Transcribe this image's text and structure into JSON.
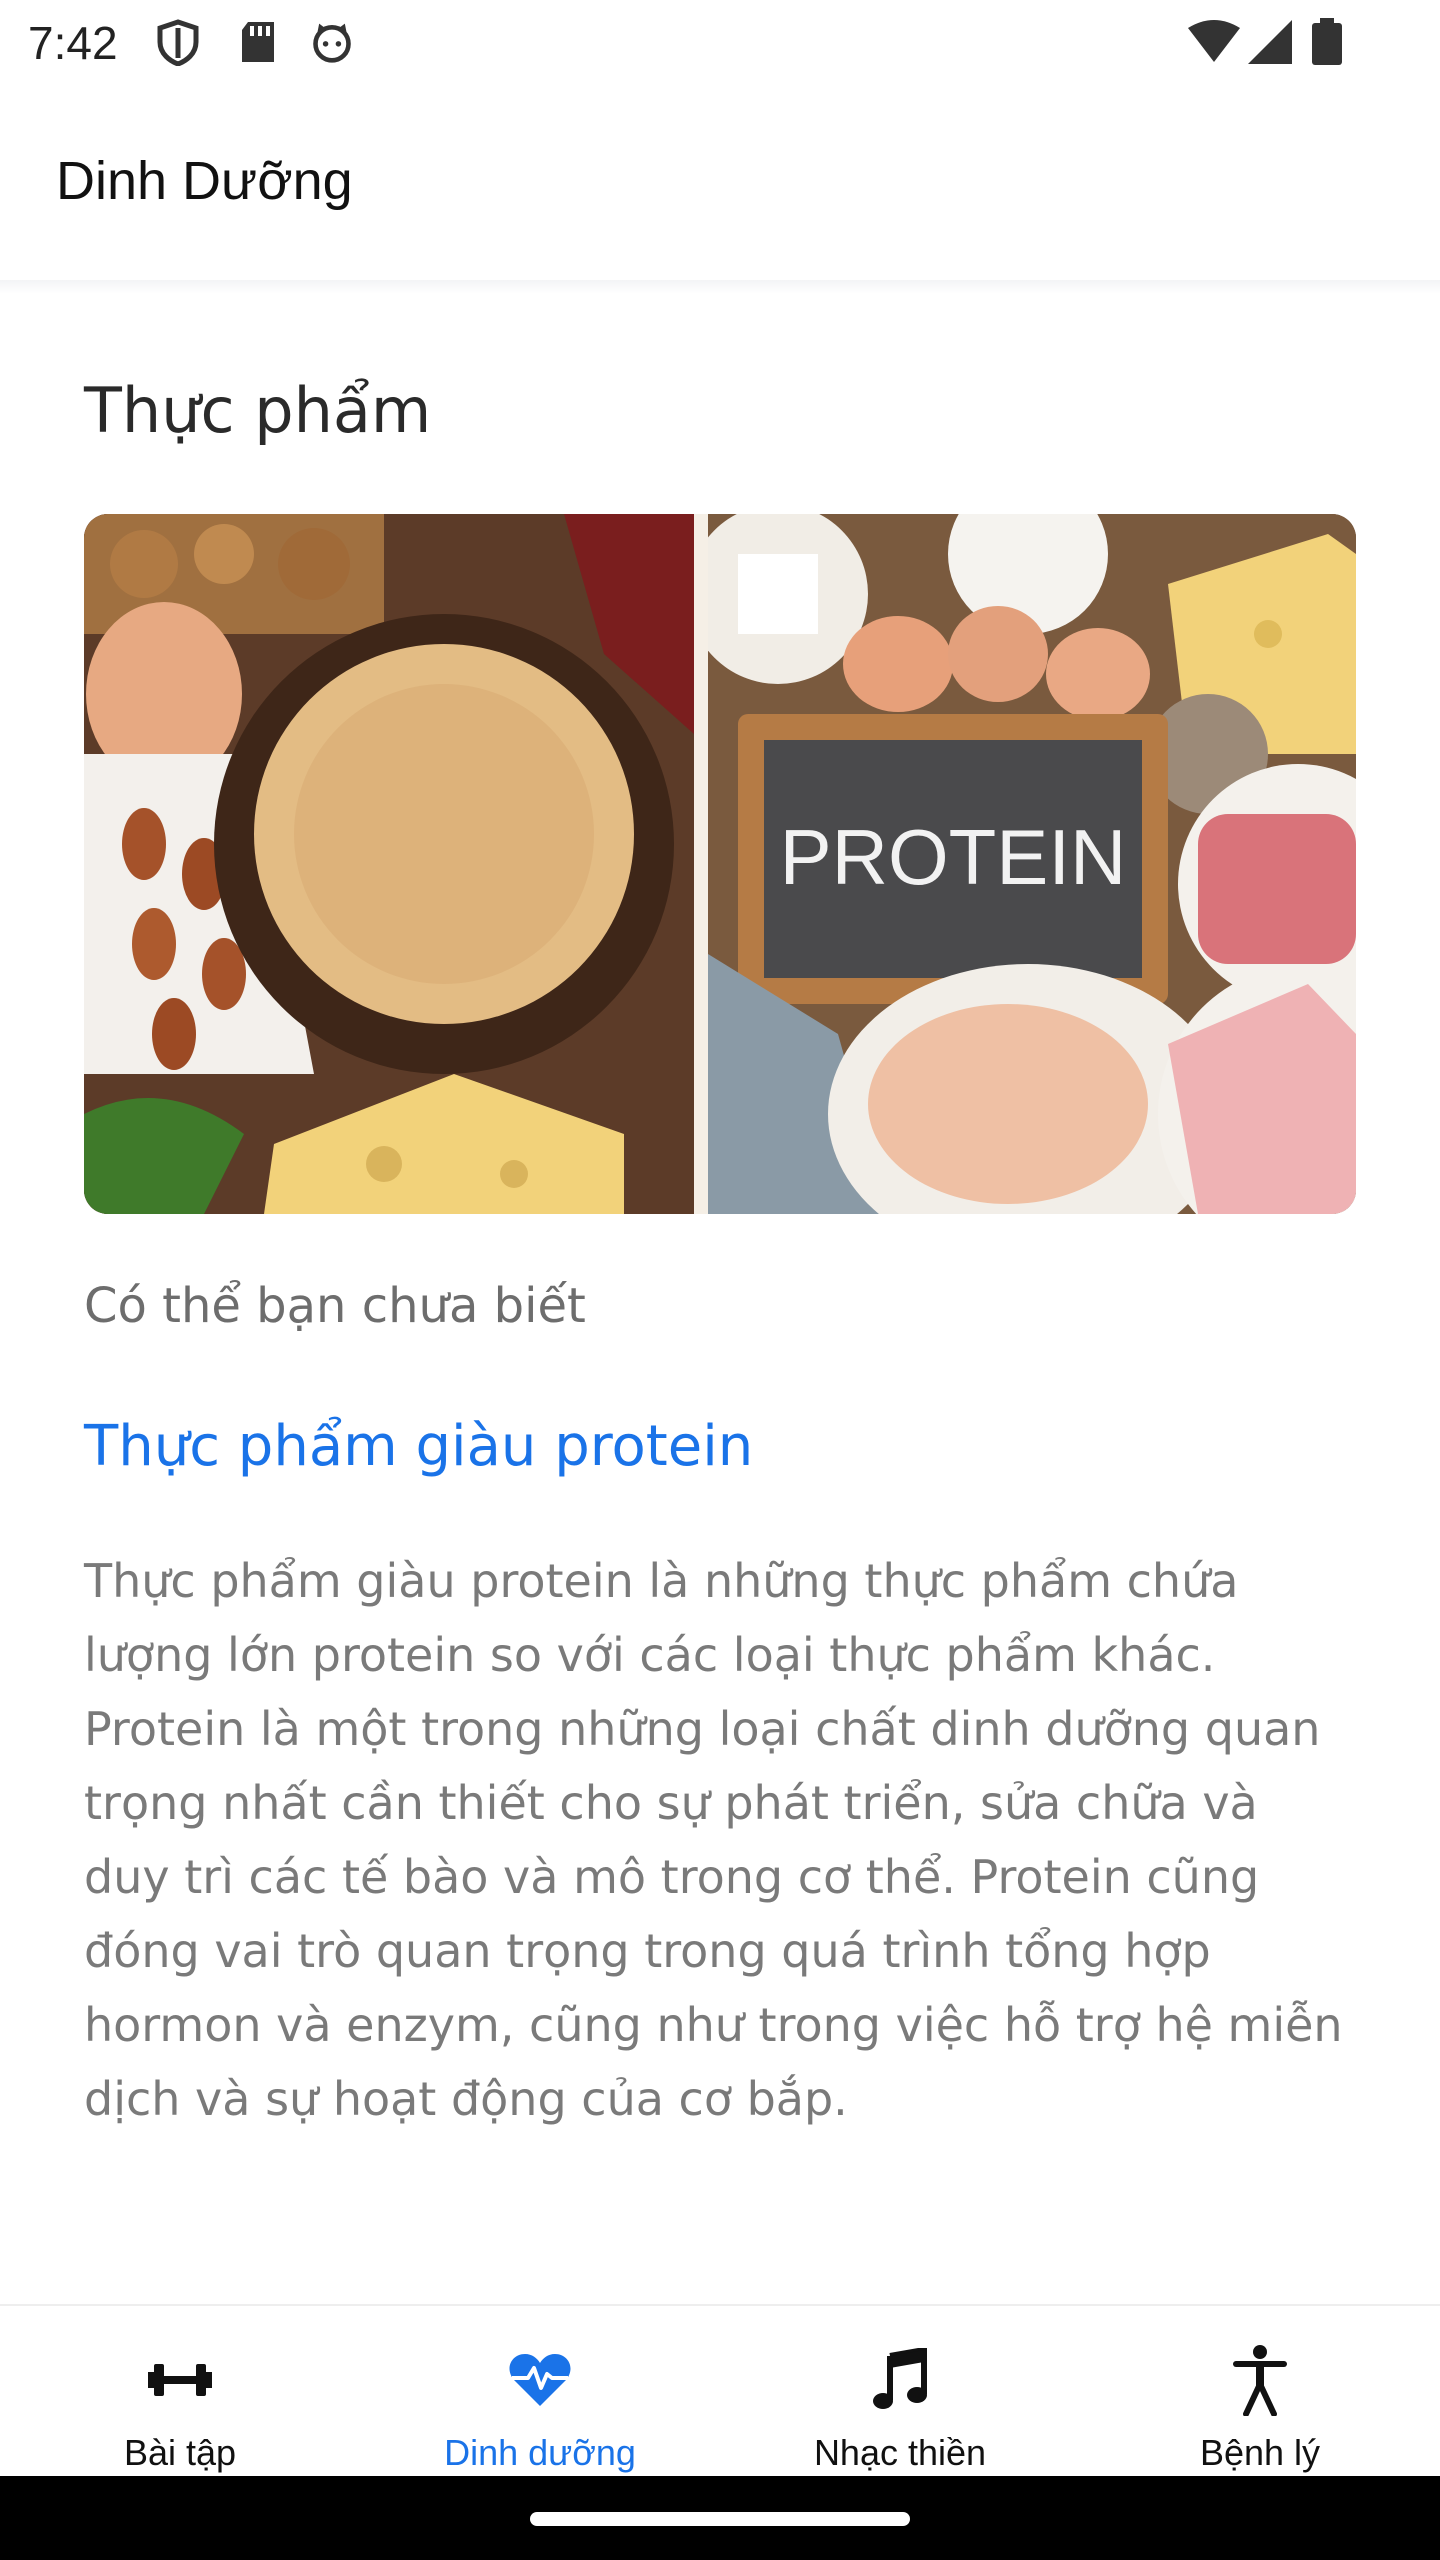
{
  "status_bar": {
    "time": "7:42",
    "left_icons": [
      "shield-icon",
      "sd-card-icon",
      "cat-face-icon"
    ],
    "right_icons": [
      "wifi-icon",
      "cell-signal-icon",
      "battery-icon"
    ]
  },
  "app_bar": {
    "title": "Dinh Dưỡng"
  },
  "content": {
    "section_title": "Thực phẩm",
    "image_label": "PROTEIN",
    "subtitle": "Có thể bạn chưa biết",
    "link_title": "Thực phẩm giàu protein",
    "body": "Thực phẩm giàu protein là những thực phẩm chứa lượng lớn protein so với các loại thực phẩm khác. Protein là một trong những loại chất dinh dưỡng quan trọng nhất cần thiết cho sự phát triển, sửa chữa và duy trì các tế bào và mô trong cơ thể. Protein cũng đóng vai trò quan trọng trong quá trình tổng hợp hormon và enzym, cũng như trong việc hỗ trợ hệ miễn dịch và sự hoạt động của cơ bắp."
  },
  "bottom_nav": {
    "items": [
      {
        "label": "Bài tập",
        "icon": "dumbbell-icon",
        "active": false
      },
      {
        "label": "Dinh dưỡng",
        "icon": "heart-pulse-icon",
        "active": true
      },
      {
        "label": "Nhạc thiền",
        "icon": "music-note-icon",
        "active": false
      },
      {
        "label": "Bệnh lý",
        "icon": "person-figure-icon",
        "active": false
      }
    ]
  },
  "colors": {
    "accent": "#1a73e8",
    "body_text": "#7a7a7a",
    "title_text": "#2a2a2a"
  }
}
